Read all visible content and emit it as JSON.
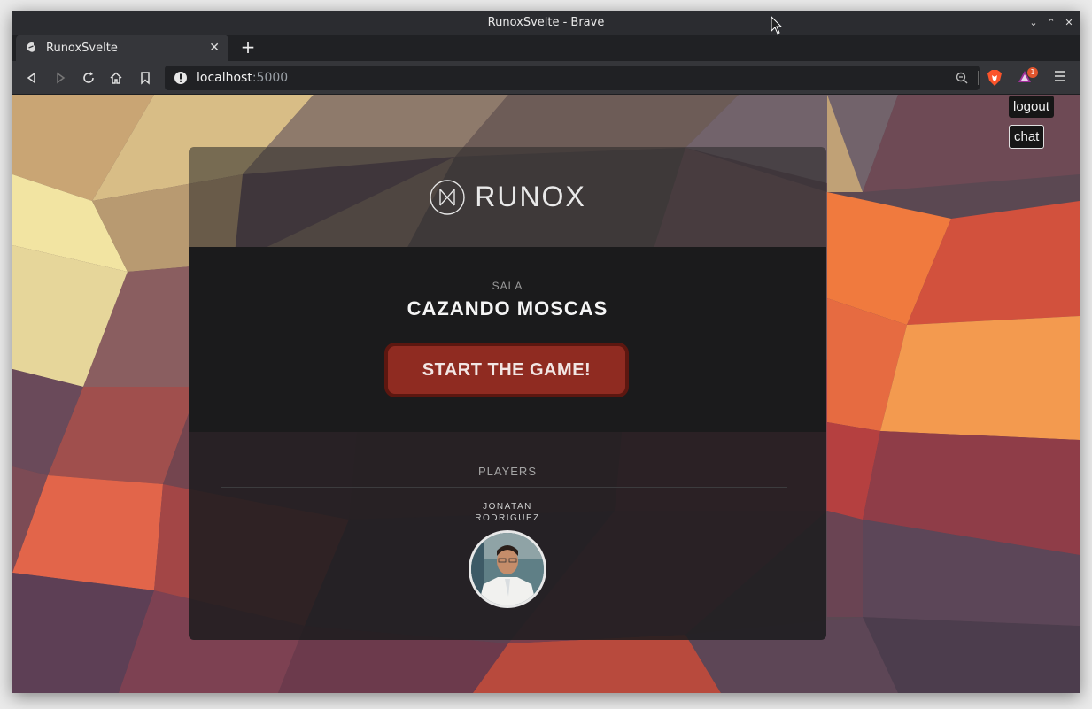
{
  "window": {
    "title": "RunoxSvelte - Brave"
  },
  "tab": {
    "title": "RunoxSvelte"
  },
  "url": {
    "host": "localhost",
    "port": ":5000"
  },
  "rewards": {
    "badge": "1"
  },
  "page": {
    "logout_label": "logout",
    "chat_label": "chat",
    "logo_text": "RUNOX",
    "sala_label": "SALA",
    "room_name": "CAZANDO MOSCAS",
    "start_label": "START THE GAME!",
    "players_label": "PLAYERS",
    "players": [
      {
        "name_line1": "JONATAN",
        "name_line2": "RODRIGUEZ"
      }
    ]
  },
  "colors": {
    "start_button": "#8f2b21",
    "card_dark": "#1b1b1c"
  }
}
